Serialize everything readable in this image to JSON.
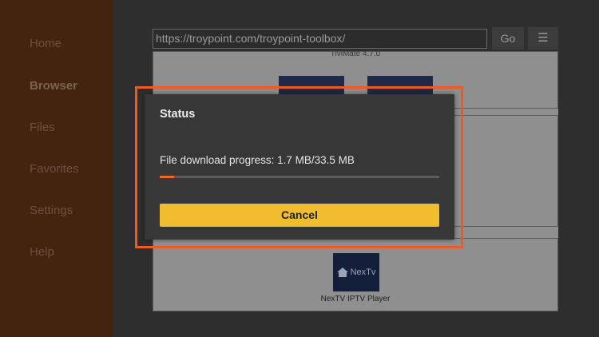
{
  "sidebar": {
    "items": [
      {
        "label": "Home"
      },
      {
        "label": "Browser",
        "active": true
      },
      {
        "label": "Files"
      },
      {
        "label": "Favorites"
      },
      {
        "label": "Settings"
      },
      {
        "label": "Help"
      }
    ]
  },
  "toolbar": {
    "url_value": "https://troypoint.com/troypoint-toolbox/",
    "go_label": "Go",
    "menu_icon": "hamburger-icon"
  },
  "content": {
    "partial_title": "TiviMate 4.7.0",
    "app_label": "NexTV IPTV Player",
    "app_logo_text": "NexTv"
  },
  "dialog": {
    "title": "Status",
    "progress_text": "File download progress: 1.7 MB/33.5 MB",
    "progress_fraction": 0.051,
    "cancel_label": "Cancel"
  },
  "colors": {
    "sidebar_bg": "#45240f",
    "progress_fill": "#f0691d",
    "cancel_bg": "#f0bd2f",
    "highlight": "#f25822"
  }
}
